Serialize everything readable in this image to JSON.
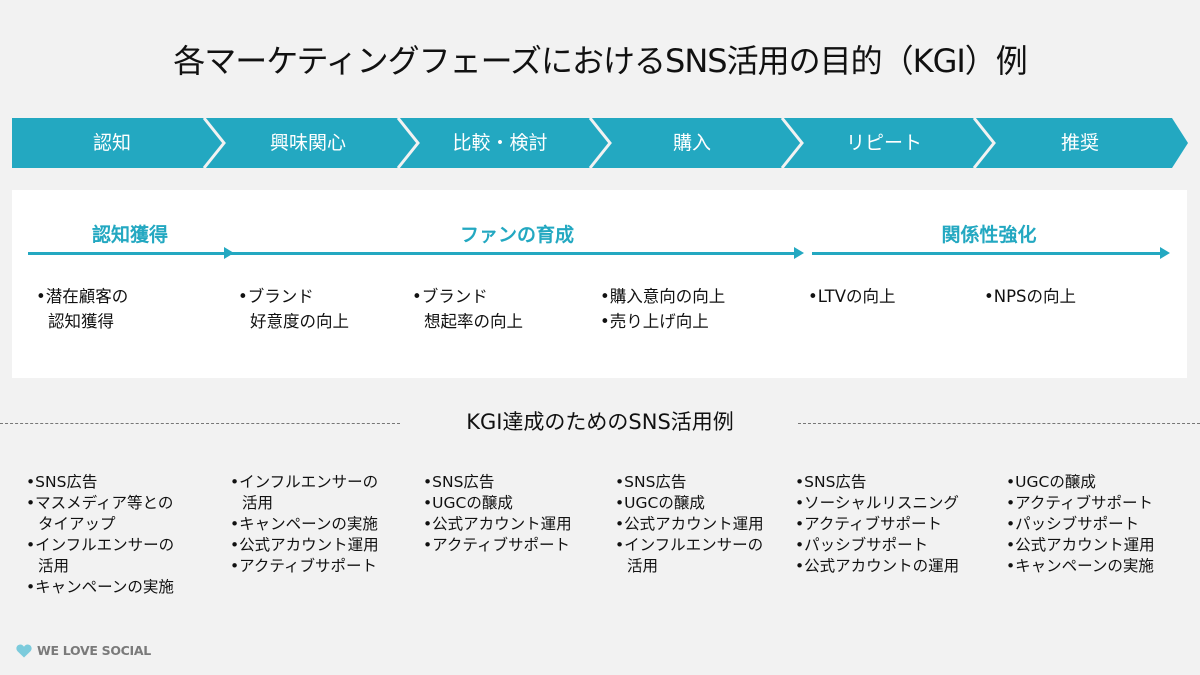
{
  "title": "各マーケティングフェーズにおけるSNS活用の目的（KGI）例",
  "colors": {
    "accent": "#23a8c1",
    "background": "#f2f2f2",
    "panel": "#ffffff",
    "text": "#111111",
    "logo_heart": "#7ccbdc",
    "logo_text": "#7a7a7a"
  },
  "phases": [
    {
      "label": "認知"
    },
    {
      "label": "興味関心"
    },
    {
      "label": "比較・検討"
    },
    {
      "label": "購入"
    },
    {
      "label": "リピート"
    },
    {
      "label": "推奨"
    }
  ],
  "goals": [
    {
      "label": "認知獲得"
    },
    {
      "label": "ファンの育成"
    },
    {
      "label": "関係性強化"
    }
  ],
  "kgi_items": [
    {
      "lines": [
        "•潜在顧客の",
        "認知獲得"
      ]
    },
    {
      "lines": [
        "•ブランド",
        "好意度の向上"
      ]
    },
    {
      "lines": [
        "•ブランド",
        "想起率の向上"
      ]
    },
    {
      "lines": [
        "•購入意向の向上",
        "•売り上げ向上"
      ]
    },
    {
      "lines": [
        "•LTVの向上"
      ]
    },
    {
      "lines": [
        "•NPSの向上"
      ]
    }
  ],
  "usecase_section": {
    "title": "KGI達成のためのSNS活用例",
    "columns": [
      [
        "•SNS広告",
        "•マスメディア等との",
        " タイアップ",
        "•インフルエンサーの",
        " 活用",
        "•キャンペーンの実施"
      ],
      [
        "•インフルエンサーの",
        " 活用",
        "•キャンペーンの実施",
        "•公式アカウント運用",
        "•アクティブサポート"
      ],
      [
        "•SNS広告",
        "•UGCの醸成",
        "•公式アカウント運用",
        "•アクティブサポート"
      ],
      [
        "•SNS広告",
        "•UGCの醸成",
        "•公式アカウント運用",
        "•インフルエンサーの",
        " 活用"
      ],
      [
        "•SNS広告",
        "•ソーシャルリスニング",
        "•アクティブサポート",
        "•パッシブサポート",
        "•公式アカウントの運用"
      ],
      [
        "•UGCの醸成",
        "•アクティブサポート",
        "•パッシブサポート",
        "•公式アカウント運用",
        "•キャンペーンの実施"
      ]
    ]
  },
  "logo": {
    "icon": "heart-icon",
    "text": "WE LOVE SOCIAL"
  }
}
